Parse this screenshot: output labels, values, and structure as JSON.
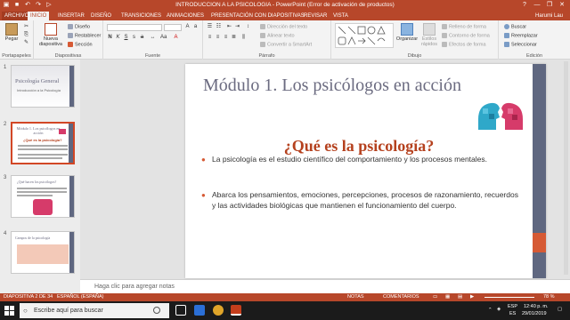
{
  "window": {
    "title": "INTRODUCCION A LA PSICOLOGIA - PowerPoint (Error de activación de productos)",
    "help": "?",
    "controls": [
      "—",
      "❐",
      "✕"
    ]
  },
  "tabs": [
    {
      "label": "ARCHIVO"
    },
    {
      "label": "INICIO"
    },
    {
      "label": "INSERTAR"
    },
    {
      "label": "DISEÑO"
    },
    {
      "label": "TRANSICIONES"
    },
    {
      "label": "ANIMACIONES"
    },
    {
      "label": "PRESENTACIÓN CON DIAPOSITIVAS"
    },
    {
      "label": "REVISAR"
    },
    {
      "label": "VISTA"
    }
  ],
  "user": "Harumi Lau",
  "ribbon": {
    "portapapeles": {
      "label": "Portapapeles",
      "pegar": "Pegar"
    },
    "diapositivas": {
      "label": "Diapositivas",
      "nueva": "Nueva diapositiva",
      "diseno": "Diseño",
      "restablecer": "Restablecer",
      "seccion": "Sección"
    },
    "fuente": {
      "label": "Fuente"
    },
    "parrafo": {
      "label": "Párrafo",
      "direccion": "Dirección del texto",
      "alinear": "Alinear texto",
      "convertir": "Convertir a SmartArt"
    },
    "dibujo": {
      "label": "Dibujo",
      "organizar": "Organizar",
      "estilos": "Estilos rápidos",
      "relleno": "Relleno de forma",
      "contorno": "Contorno de forma",
      "efectos": "Efectos de forma"
    },
    "edicion": {
      "label": "Edición",
      "buscar": "Buscar",
      "reemplazar": "Reemplazar",
      "seleccionar": "Seleccionar"
    }
  },
  "thumbnails": [
    {
      "num": "1",
      "title": "Psicología General",
      "subtitle": "Introducción a la Psicología"
    },
    {
      "num": "2",
      "title": "Módulo 1. Los psicólogos en acción",
      "subtitle": "¿Qué es la psicología?"
    },
    {
      "num": "3",
      "title": "¿Qué hacen los psicólogos?",
      "subtitle": ""
    },
    {
      "num": "4",
      "title": "Campos de la psicología",
      "subtitle": ""
    }
  ],
  "slide": {
    "title": "Módulo 1. Los psicólogos en acción",
    "subtitle": "¿Qué es la psicología?",
    "bullets": [
      "La psicología es el estudio científico del comportamiento y los procesos mentales.",
      "Abarca los pensamientos, emociones, percepciones, procesos de razonamiento, recuerdos y las actividades biológicas que mantienen el funcionamiento del cuerpo."
    ]
  },
  "notes_placeholder": "Haga clic para agregar notas",
  "status": {
    "slide_info": "DIAPOSITIVA 2 DE 34",
    "language": "ESPAÑOL (ESPAÑA)",
    "notes": "NOTAS",
    "comments": "COMENTARIOS",
    "zoom": "78 %"
  },
  "taskbar": {
    "search_placeholder": "Escribe aquí para buscar",
    "lang": "ESP",
    "lang2": "ES",
    "time": "12:40 p. m.",
    "date": "29/01/2019"
  },
  "colors": {
    "brand": "#b7472a",
    "slide_strip": "#5f6780",
    "accent": "#d65a35"
  }
}
